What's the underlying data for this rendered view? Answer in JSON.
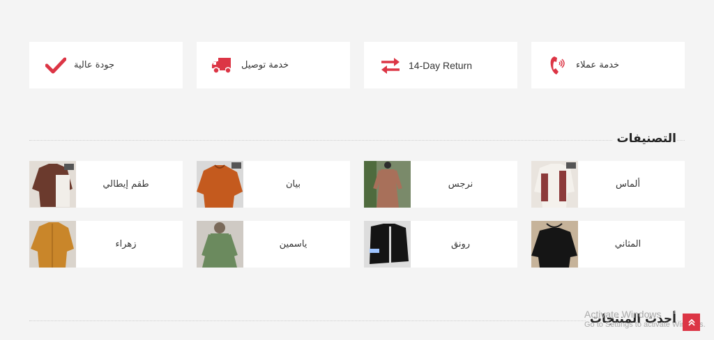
{
  "features": [
    {
      "label": "جودة عالية",
      "icon": "check-icon"
    },
    {
      "label": "خدمة توصيل",
      "icon": "truck-icon"
    },
    {
      "label": "14-Day Return",
      "icon": "exchange-arrows-icon"
    },
    {
      "label": "خدمة عملاء",
      "icon": "phone-icon"
    }
  ],
  "categories_section": {
    "title": "التصنيفات"
  },
  "categories": [
    {
      "name": "طقم إيطالي"
    },
    {
      "name": "بيان"
    },
    {
      "name": "نرجس"
    },
    {
      "name": "ألماس"
    },
    {
      "name": "زهراء"
    },
    {
      "name": "ياسمين"
    },
    {
      "name": "رونق"
    },
    {
      "name": "المثاني"
    }
  ],
  "latest_section": {
    "title": "أحدث المنتجات"
  },
  "windows_watermark": {
    "line1": "Activate Windows",
    "line2": "Go to Settings to activate Windows."
  },
  "colors": {
    "accent": "#dc3545",
    "background": "#f4f4f4",
    "card": "#ffffff"
  }
}
